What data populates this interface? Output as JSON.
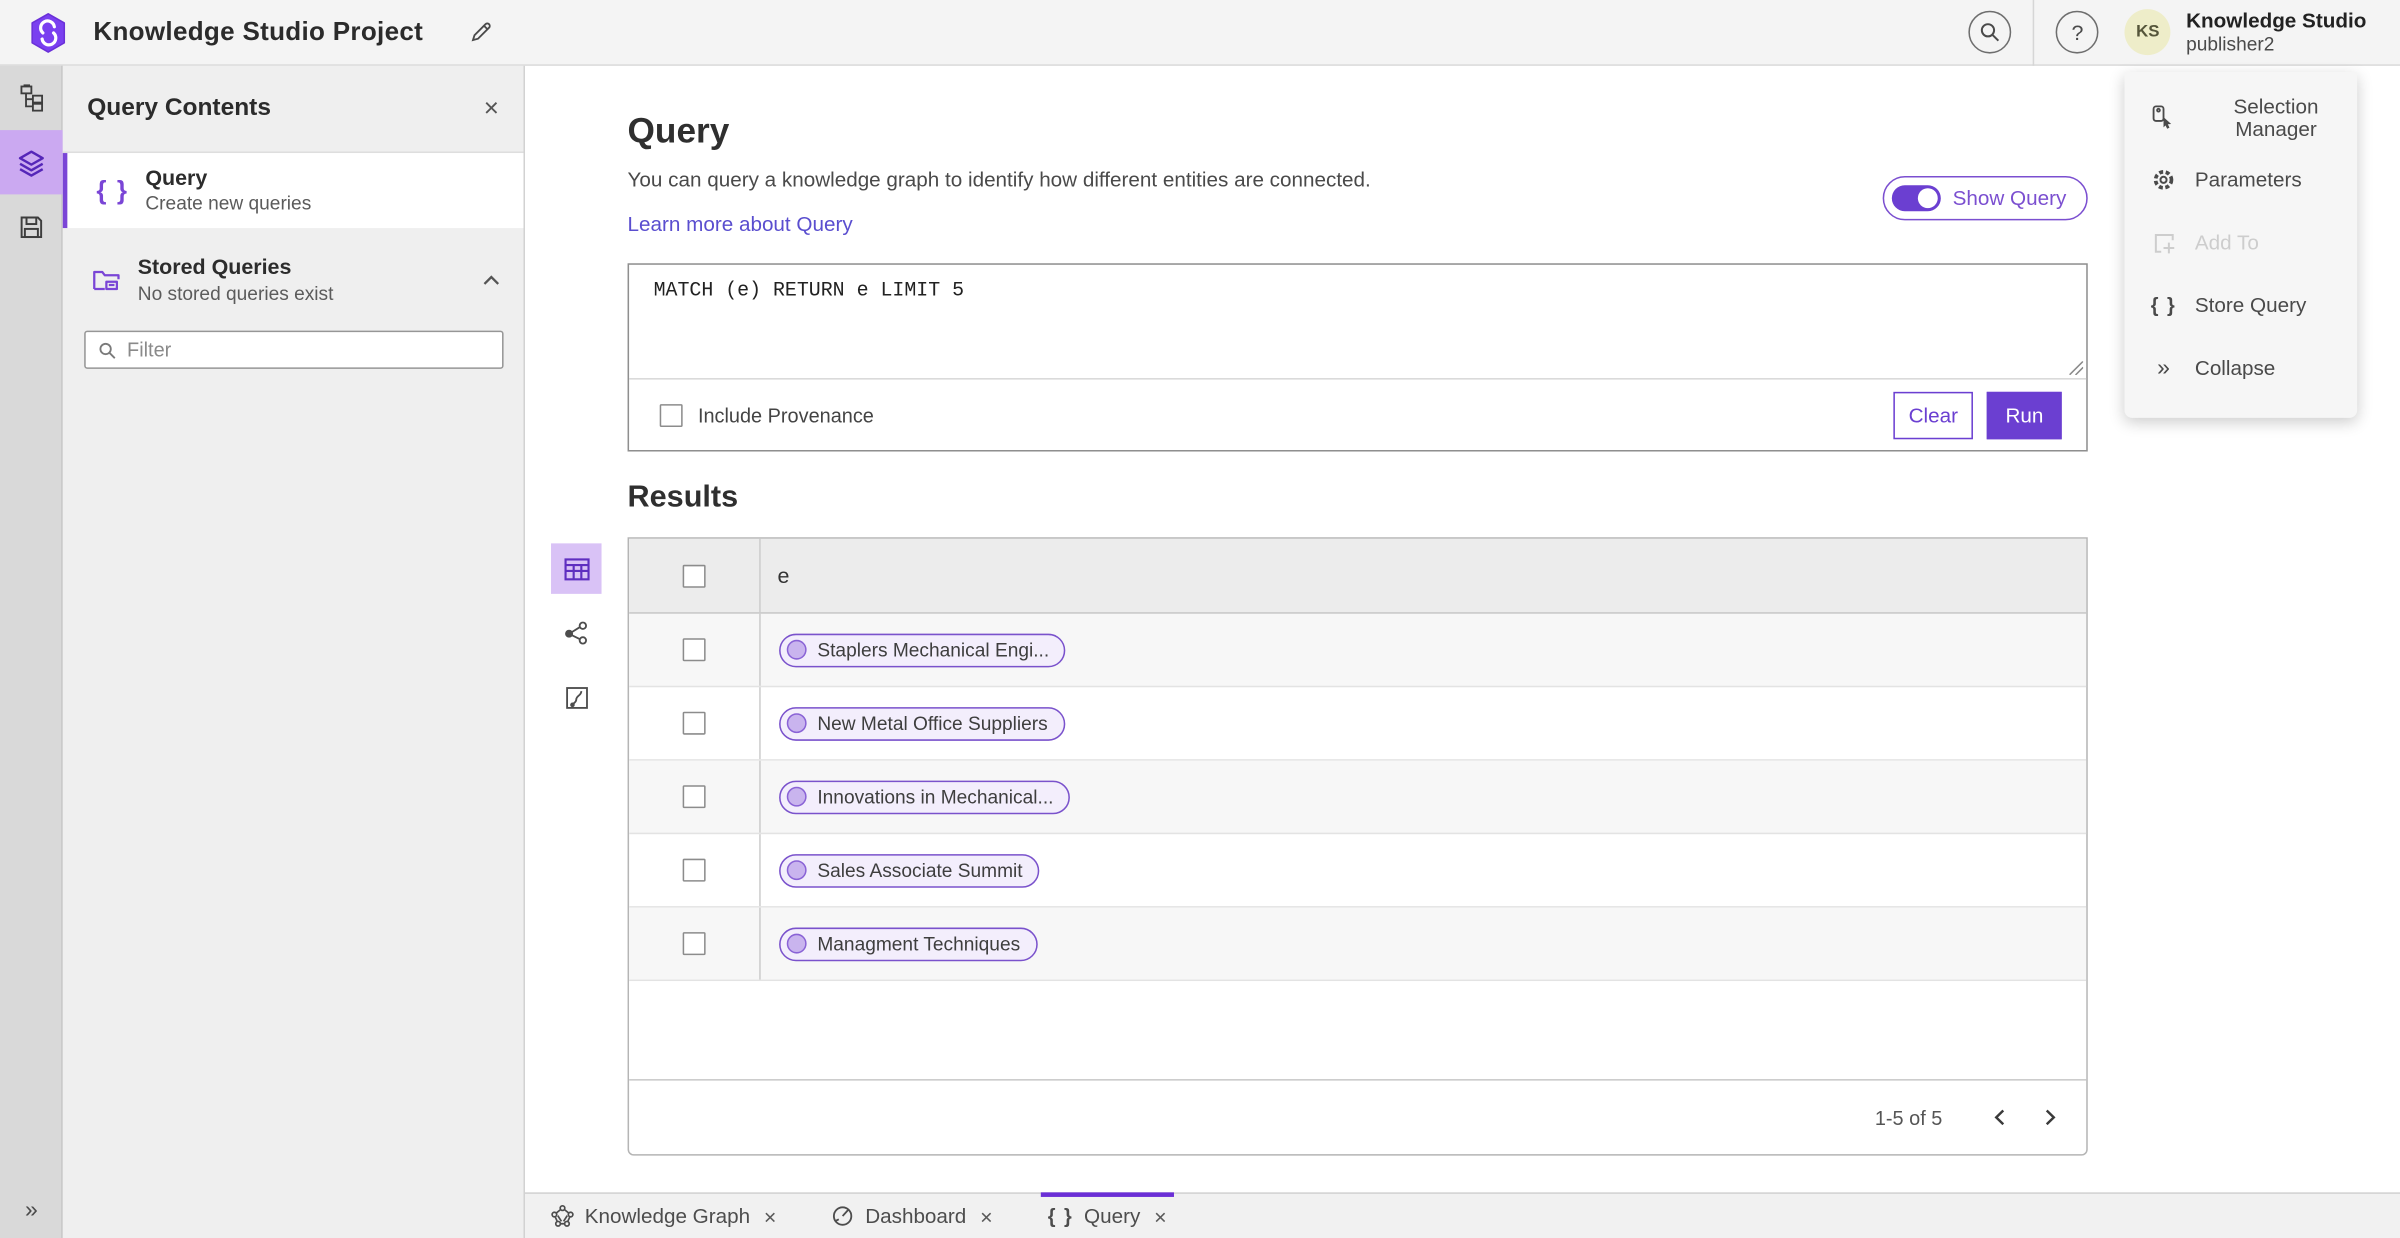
{
  "header": {
    "title": "Knowledge Studio Project",
    "user": {
      "name": "Knowledge Studio",
      "role": "publisher2",
      "initials": "KS"
    }
  },
  "glyphs": {
    "close": "×",
    "help": "?",
    "braces": "{ }",
    "collapse_chevrons": "»"
  },
  "left_panel": {
    "title": "Query Contents",
    "query_item": {
      "title": "Query",
      "subtitle": "Create new queries"
    },
    "stored_item": {
      "title": "Stored Queries",
      "subtitle": "No stored queries exist"
    },
    "filter_placeholder": "Filter"
  },
  "query": {
    "heading": "Query",
    "description": "You can query a knowledge graph to identify how different entities are connected.",
    "learn_more": "Learn more about Query",
    "show_query": "Show Query",
    "text": "MATCH (e) RETURN e LIMIT 5",
    "include_provenance": "Include Provenance",
    "clear": "Clear",
    "run": "Run"
  },
  "results": {
    "heading": "Results",
    "column": "e",
    "rows": [
      "Staplers Mechanical Engi...",
      "New Metal Office Suppliers",
      "Innovations in Mechanical...",
      "Sales Associate Summit",
      "Managment Techniques"
    ],
    "pagination": "1-5 of 5"
  },
  "side_menu": {
    "items": [
      {
        "label": "Selection Manager",
        "disabled": false
      },
      {
        "label": "Parameters",
        "disabled": false
      },
      {
        "label": "Add To",
        "disabled": true
      },
      {
        "label": "Store Query",
        "disabled": false
      },
      {
        "label": "Collapse",
        "disabled": false
      }
    ]
  },
  "tabs": [
    {
      "label": "Knowledge Graph",
      "active": false
    },
    {
      "label": "Dashboard",
      "active": false
    },
    {
      "label": "Query",
      "active": true
    }
  ],
  "colors": {
    "accent": "#6b3fd1",
    "accent_light": "#cba9f1",
    "link": "#5a4ecf",
    "chip_border": "#7a52cc",
    "chip_bg": "#f3eefc",
    "avatar_bg": "#eeedc9",
    "header_bg": "#f4f4f4",
    "panel_bg": "#efefef",
    "rail_bg": "#d9d9d9"
  }
}
